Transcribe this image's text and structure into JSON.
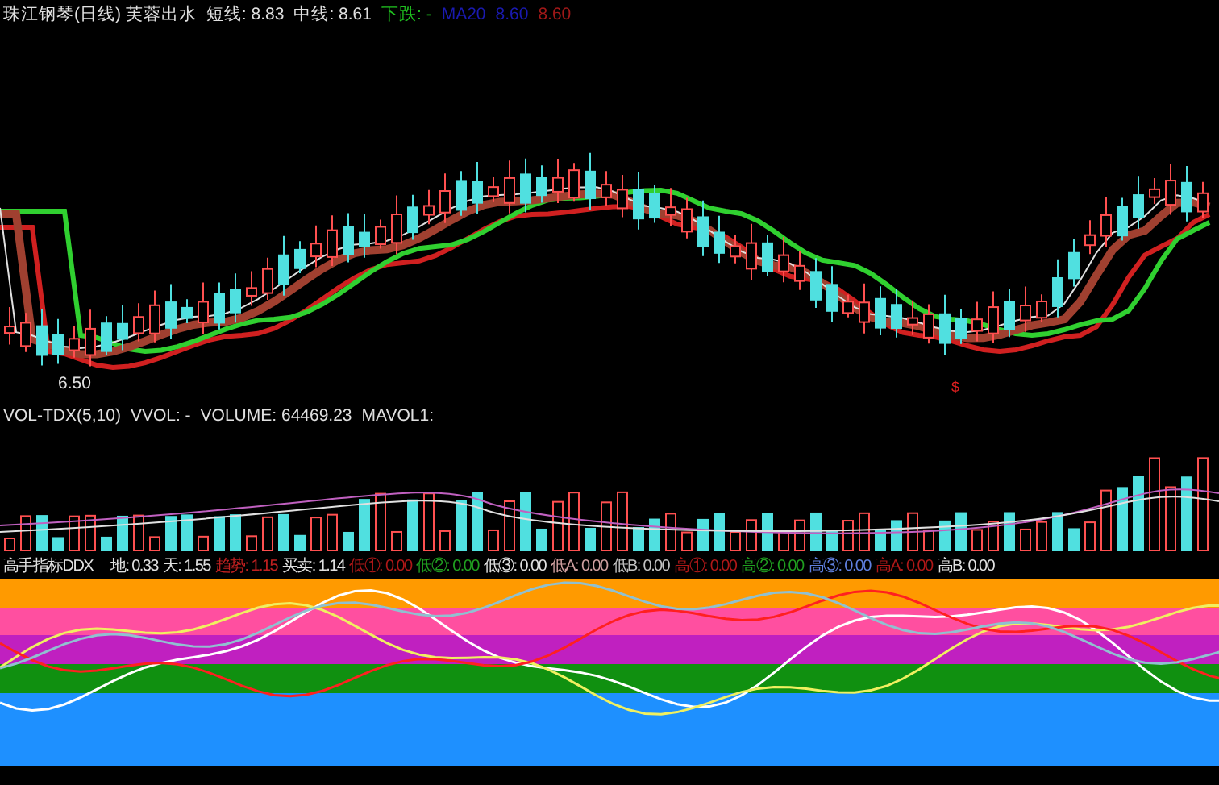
{
  "price_panel": {
    "title": "珠江钢琴(日线) 芙蓉出水",
    "indicators": [
      {
        "text": "短线: 8.83",
        "color": "#e0e0e0"
      },
      {
        "text": "中线: 8.61",
        "color": "#e0e0e0"
      },
      {
        "text": "下跌: -",
        "color": "#20c020"
      },
      {
        "text": "MA20",
        "color": "#1a1ab0"
      },
      {
        "text": "8.60",
        "color": "#1a1ab0"
      },
      {
        "text": "8.60",
        "color": "#a01818"
      }
    ],
    "low_label": "6.50",
    "signal_mark": "$"
  },
  "volume_panel": {
    "title": "VOL-TDX(5,10)",
    "indicators": [
      {
        "text": "VVOL: -",
        "color": "#e0e0e0"
      },
      {
        "text": "VOLUME: 64469.23",
        "color": "#e0e0e0"
      },
      {
        "text": "MAVOL1:",
        "color": "#e0e0e0"
      }
    ]
  },
  "ddx_panel": {
    "title": "高手指标DDX",
    "indicators": [
      {
        "text": "地: 0.33",
        "color": "#e0e0e0"
      },
      {
        "text": "天: 1.55",
        "color": "#e0e0e0"
      },
      {
        "text": "趋势: 1.15",
        "color": "#c02020"
      },
      {
        "text": "买卖: 1.14",
        "color": "#e0e0e0"
      },
      {
        "text": "低①: 0.00",
        "color": "#b01818"
      },
      {
        "text": "低②: 0.00",
        "color": "#20a020"
      },
      {
        "text": "低③: 0.00",
        "color": "#e0e0e0"
      },
      {
        "text": "低A: 0.00",
        "color": "#d0a0a0"
      },
      {
        "text": "低B: 0.00",
        "color": "#c0c0c0"
      },
      {
        "text": "高①: 0.00",
        "color": "#b01818"
      },
      {
        "text": "高②: 0.00",
        "color": "#20a020"
      },
      {
        "text": "高③: 0.00",
        "color": "#6080e0"
      },
      {
        "text": "高A: 0.00",
        "color": "#b01818"
      },
      {
        "text": "高B: 0.00",
        "color": "#e0e0e0"
      }
    ]
  }
}
